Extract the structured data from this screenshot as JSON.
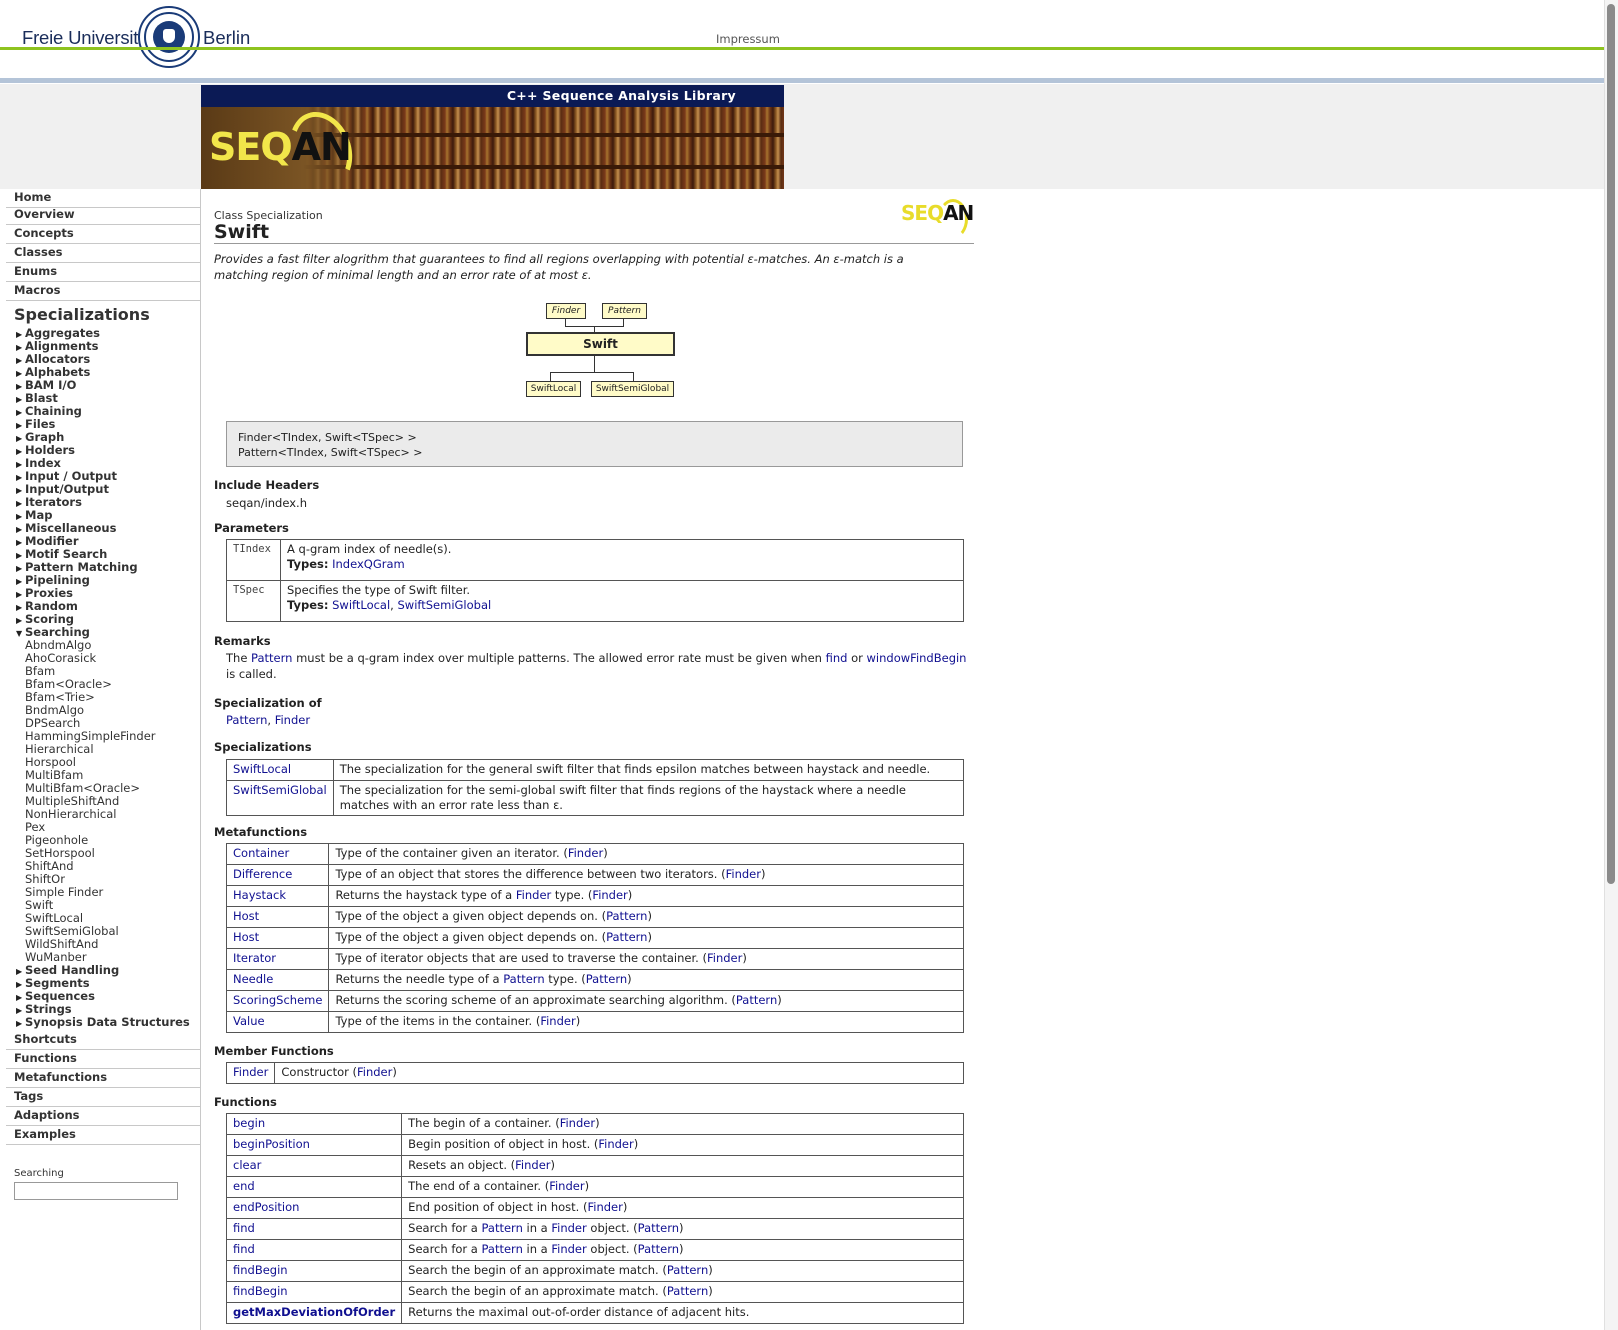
{
  "header": {
    "university_left": "Freie Universität",
    "university_right": "Berlin",
    "impressum": "Impressum",
    "banner_title": "C++ Sequence Analysis Library",
    "banner_logo_seq": "SEQ",
    "banner_logo_an": "AN"
  },
  "sidebar": {
    "top_items": [
      "Home",
      "Overview",
      "Concepts",
      "Classes",
      "Enums",
      "Macros"
    ],
    "specializations_heading": "Specializations",
    "categories_before": [
      "Aggregates",
      "Alignments",
      "Allocators",
      "Alphabets",
      "BAM I/O",
      "Blast",
      "Chaining",
      "Files",
      "Graph",
      "Holders",
      "Index",
      "Input / Output",
      "Input/Output",
      "Iterators",
      "Map",
      "Miscellaneous",
      "Modifier",
      "Motif Search",
      "Pattern Matching",
      "Pipelining",
      "Proxies",
      "Random",
      "Scoring"
    ],
    "expanded_category": "Searching",
    "expanded_items": [
      "AbndmAlgo",
      "AhoCorasick",
      "Bfam",
      "Bfam<Oracle>",
      "Bfam<Trie>",
      "BndmAlgo",
      "DPSearch",
      "HammingSimpleFinder",
      "Hierarchical",
      "Horspool",
      "MultiBfam",
      "MultiBfam<Oracle>",
      "MultipleShiftAnd",
      "NonHierarchical",
      "Pex",
      "Pigeonhole",
      "SetHorspool",
      "ShiftAnd",
      "ShiftOr",
      "Simple Finder",
      "Swift",
      "SwiftLocal",
      "SwiftSemiGlobal",
      "WildShiftAnd",
      "WuManber"
    ],
    "categories_after": [
      "Seed Handling",
      "Segments",
      "Sequences",
      "Strings",
      "Synopsis Data Structures"
    ],
    "bottom_items": [
      "Shortcuts",
      "Functions",
      "Metafunctions",
      "Tags",
      "Adaptions",
      "Examples"
    ],
    "search_label": "Searching",
    "search_value": ""
  },
  "main": {
    "kind": "Class Specialization",
    "title": "Swift",
    "logo_seq": "SEQ",
    "logo_an": "AN",
    "description": "Provides a fast filter alogrithm that guarantees to find all regions overlapping with potential ε-matches. An ε-match is a matching region of minimal length and an error rate of at most ε.",
    "diagram": {
      "parents": [
        "Finder",
        "Pattern"
      ],
      "current": "Swift",
      "children": [
        "SwiftLocal",
        "SwiftSemiGlobal"
      ]
    },
    "synopsis": [
      "Finder<TIndex, Swift<TSpec> >",
      "Pattern<TIndex, Swift<TSpec> >"
    ],
    "include_headers_heading": "Include Headers",
    "include_header": "seqan/index.h",
    "parameters_heading": "Parameters",
    "parameters": [
      {
        "name": "TIndex",
        "desc": "A q-gram index of needle(s).",
        "types_label": "Types:",
        "types": [
          "IndexQGram"
        ]
      },
      {
        "name": "TSpec",
        "desc": "Specifies the type of Swift filter.",
        "types_label": "Types:",
        "types": [
          "SwiftLocal",
          "SwiftSemiGlobal"
        ]
      }
    ],
    "remarks_heading": "Remarks",
    "remarks": {
      "t1": "The ",
      "l1": "Pattern",
      "t2": " must be a q-gram index over multiple patterns. The allowed error rate must be given when ",
      "l2": "find",
      "t3": " or ",
      "l3": "windowFindBegin",
      "t4": "is called."
    },
    "specialization_of_heading": "Specialization of",
    "specialization_of": [
      "Pattern",
      "Finder"
    ],
    "specializations_heading": "Specializations",
    "specializations": [
      {
        "name": "SwiftLocal",
        "desc": "The specialization for the general swift filter that finds epsilon matches between haystack and needle."
      },
      {
        "name": "SwiftSemiGlobal",
        "desc": "The specialization for the semi-global swift filter that finds regions of the haystack where a needle matches with an error rate less than ε."
      }
    ],
    "metafunctions_heading": "Metafunctions",
    "metafunctions": [
      {
        "name": "Container",
        "pre": "Type of the container given an iterator. (",
        "mid_link": "",
        "mid_text": "",
        "ref": "Finder",
        "post": ")"
      },
      {
        "name": "Difference",
        "pre": "Type of an object that stores the difference between two iterators. (",
        "mid_link": "",
        "mid_text": "",
        "ref": "Finder",
        "post": ")"
      },
      {
        "name": "Haystack",
        "pre": "Returns the haystack type of a ",
        "mid_link": "Finder",
        "mid_text": " type. (",
        "ref": "Finder",
        "post": ")"
      },
      {
        "name": "Host",
        "pre": "Type of the object a given object depends on. (",
        "mid_link": "",
        "mid_text": "",
        "ref": "Pattern",
        "post": ")"
      },
      {
        "name": "Host",
        "pre": "Type of the object a given object depends on. (",
        "mid_link": "",
        "mid_text": "",
        "ref": "Pattern",
        "post": ")"
      },
      {
        "name": "Iterator",
        "pre": "Type of iterator objects that are used to traverse the container. (",
        "mid_link": "",
        "mid_text": "",
        "ref": "Finder",
        "post": ")"
      },
      {
        "name": "Needle",
        "pre": "Returns the needle type of a ",
        "mid_link": "Pattern",
        "mid_text": " type. (",
        "ref": "Pattern",
        "post": ")"
      },
      {
        "name": "ScoringScheme",
        "pre": "Returns the scoring scheme of an approximate searching algorithm. (",
        "mid_link": "",
        "mid_text": "",
        "ref": "Pattern",
        "post": ")"
      },
      {
        "name": "Value",
        "pre": "Type of the items in the container. (",
        "mid_link": "",
        "mid_text": "",
        "ref": "Finder",
        "post": ")"
      }
    ],
    "member_functions_heading": "Member Functions",
    "member_functions": [
      {
        "name": "Finder",
        "pre": "Constructor (",
        "ref": "Finder",
        "post": ")"
      }
    ],
    "functions_heading": "Functions",
    "functions": [
      {
        "name": "begin",
        "pre": "The begin of a container. (",
        "l1": "",
        "t1": "",
        "l2": "",
        "t2": "",
        "ref": "Finder",
        "post": ")"
      },
      {
        "name": "beginPosition",
        "pre": "Begin position of object in host. (",
        "l1": "",
        "t1": "",
        "l2": "",
        "t2": "",
        "ref": "Finder",
        "post": ")"
      },
      {
        "name": "clear",
        "pre": "Resets an object. (",
        "l1": "",
        "t1": "",
        "l2": "",
        "t2": "",
        "ref": "Finder",
        "post": ")"
      },
      {
        "name": "end",
        "pre": "The end of a container. (",
        "l1": "",
        "t1": "",
        "l2": "",
        "t2": "",
        "ref": "Finder",
        "post": ")"
      },
      {
        "name": "endPosition",
        "pre": "End position of object in host. (",
        "l1": "",
        "t1": "",
        "l2": "",
        "t2": "",
        "ref": "Finder",
        "post": ")"
      },
      {
        "name": "find",
        "pre": "Search for a ",
        "l1": "Pattern",
        "t1": " in a ",
        "l2": "Finder",
        "t2": " object. (",
        "ref": "Pattern",
        "post": ")"
      },
      {
        "name": "find",
        "pre": "Search for a ",
        "l1": "Pattern",
        "t1": " in a ",
        "l2": "Finder",
        "t2": " object. (",
        "ref": "Pattern",
        "post": ")"
      },
      {
        "name": "findBegin",
        "pre": "Search the begin of an approximate match. (",
        "l1": "",
        "t1": "",
        "l2": "",
        "t2": "",
        "ref": "Pattern",
        "post": ")"
      },
      {
        "name": "findBegin",
        "pre": "Search the begin of an approximate match. (",
        "l1": "",
        "t1": "",
        "l2": "",
        "t2": "",
        "ref": "Pattern",
        "post": ")"
      },
      {
        "name": "getMaxDeviationOfOrder",
        "pre": "Returns the maximal out-of-order distance of adjacent hits.",
        "l1": "",
        "t1": "",
        "l2": "",
        "t2": "",
        "ref": "",
        "post": ""
      }
    ]
  }
}
